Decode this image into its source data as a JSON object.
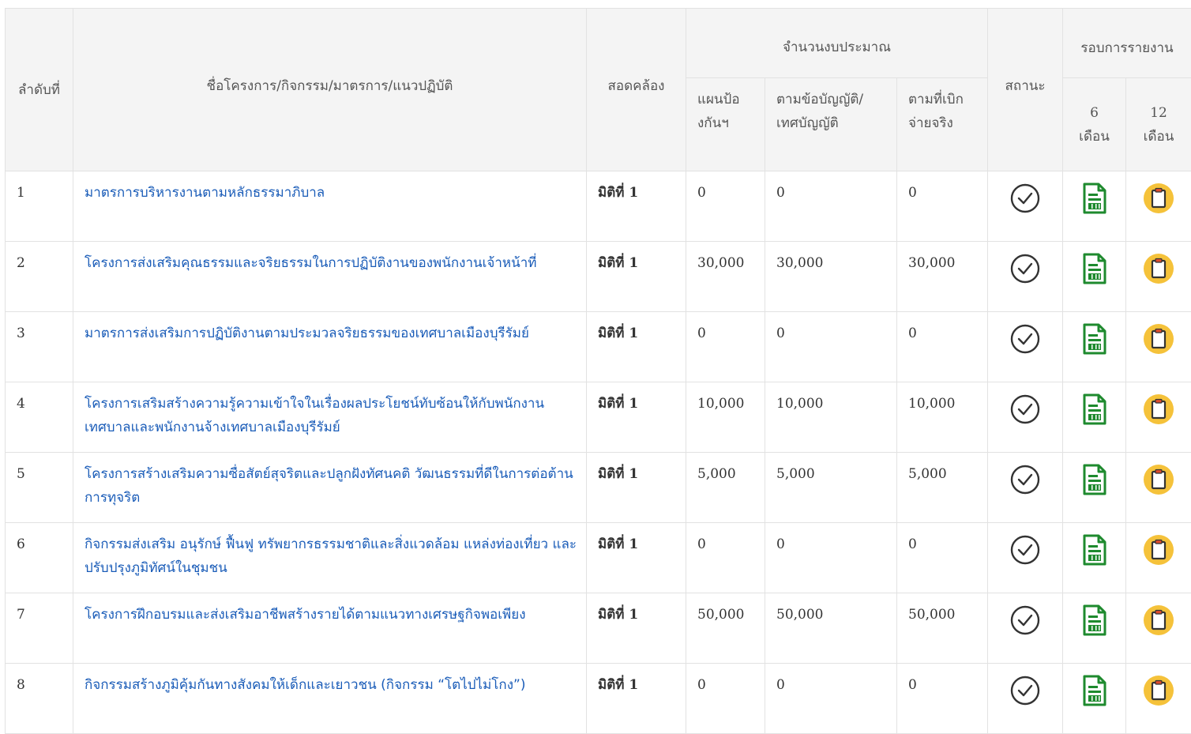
{
  "header": {
    "seq": "ลำดับที่",
    "name": "ชื่อโครงการ/กิจกรรม/มาตรการ/แนวปฏิบัติ",
    "consistent": "สอดคล้อง",
    "budget": "จำนวนงบประมาณ",
    "budget_plan": "แผนป้องกันฯ",
    "budget_law": "ตามข้อบัญญัติ/เทศบัญญัติ",
    "budget_actual": "ตามที่เบิกจ่ายจริง",
    "status": "สถานะ",
    "round": "รอบการรายงาน",
    "round_6_num": "6",
    "round_6_unit": "เดือน",
    "round_12_num": "12",
    "round_12_unit": "เดือน"
  },
  "icons": {
    "status": "check-circle-icon",
    "report6": "spreadsheet-document-icon",
    "report12": "clipboard-icon"
  },
  "colors": {
    "link": "#1a5cb8",
    "doc_green": "#1e8a2e",
    "clip_yellow": "#f5c23a"
  },
  "rows": [
    {
      "seq": "1",
      "name": "มาตรการบริหารงานตามหลักธรรมาภิบาล",
      "consistent": "มิติที่ 1",
      "plan": "0",
      "law": "0",
      "actual": "0"
    },
    {
      "seq": "2",
      "name": "โครงการส่งเสริมคุณธรรมและจริยธรรมในการปฏิบัติงานของพนักงานเจ้าหน้าที่",
      "consistent": "มิติที่ 1",
      "plan": "30,000",
      "law": "30,000",
      "actual": "30,000"
    },
    {
      "seq": "3",
      "name": "มาตรการส่งเสริมการปฏิบัติงานตามประมวลจริยธรรมของเทศบาลเมืองบุรีรัมย์",
      "consistent": "มิติที่ 1",
      "plan": "0",
      "law": "0",
      "actual": "0"
    },
    {
      "seq": "4",
      "name": "โครงการเสริมสร้างความรู้ความเข้าใจในเรื่องผลประโยชน์ทับซ้อนให้กับพนักงานเทศบาลและพนักงานจ้างเทศบาลเมืองบุรีรัมย์",
      "consistent": "มิติที่ 1",
      "plan": "10,000",
      "law": "10,000",
      "actual": "10,000"
    },
    {
      "seq": "5",
      "name": "โครงการสร้างเสริมความซื่อสัตย์สุจริตและปลูกฝังทัศนคติ วัฒนธรรมที่ดีในการต่อต้านการทุจริต",
      "consistent": "มิติที่ 1",
      "plan": "5,000",
      "law": "5,000",
      "actual": "5,000"
    },
    {
      "seq": "6",
      "name": "กิจกรรมส่งเสริม อนุรักษ์ ฟื้นฟู ทรัพยากรธรรมชาติและสิ่งแวดล้อม แหล่งท่องเที่ยว และปรับปรุงภูมิทัศน์ในชุมชน",
      "consistent": "มิติที่ 1",
      "plan": "0",
      "law": "0",
      "actual": "0"
    },
    {
      "seq": "7",
      "name": "โครงการฝึกอบรมและส่งเสริมอาชีพสร้างรายได้ตามแนวทางเศรษฐกิจพอเพียง",
      "consistent": "มิติที่ 1",
      "plan": "50,000",
      "law": "50,000",
      "actual": "50,000"
    },
    {
      "seq": "8",
      "name": "กิจกรรมสร้างภูมิคุ้มกันทางสังคมให้เด็กและเยาวชน (กิจกรรม “โตไปไม่โกง”)",
      "consistent": "มิติที่ 1",
      "plan": "0",
      "law": "0",
      "actual": "0"
    }
  ]
}
